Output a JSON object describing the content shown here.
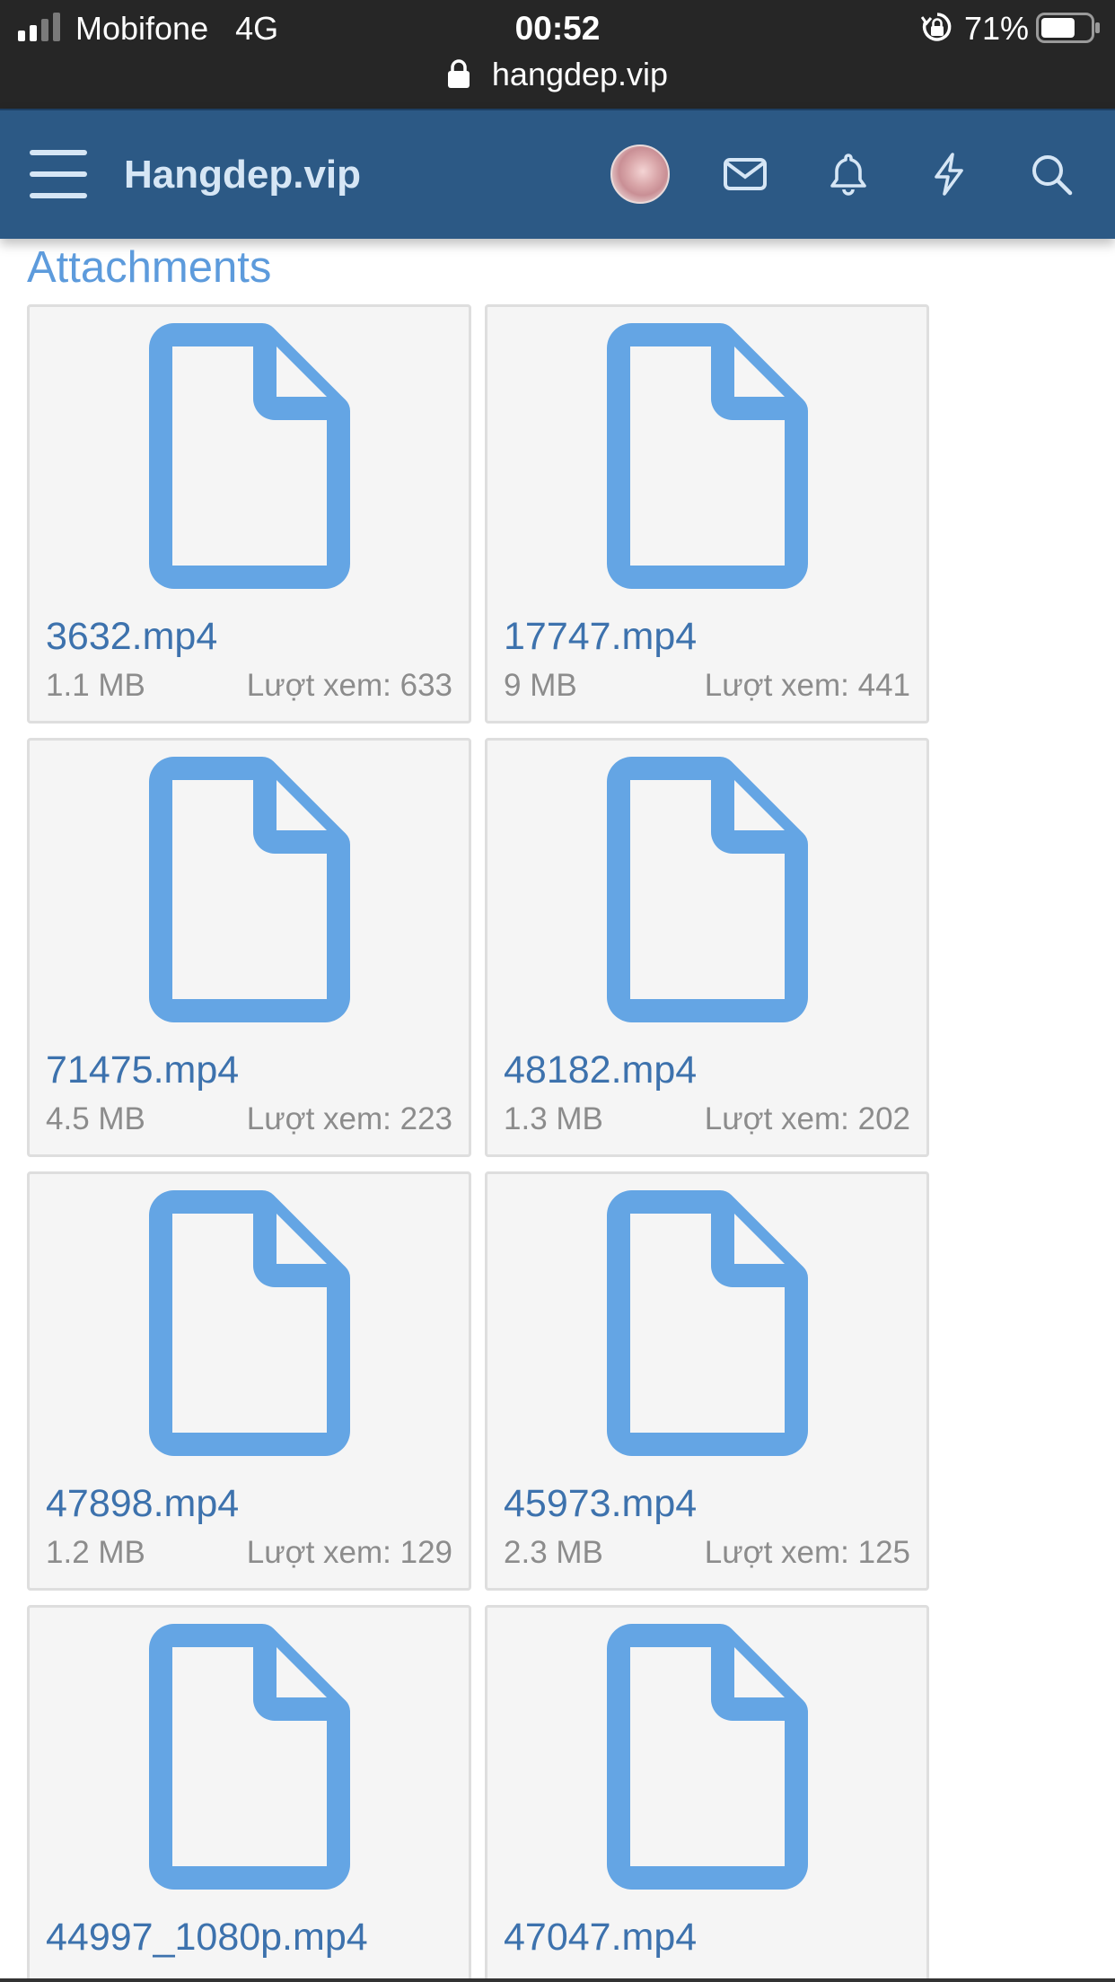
{
  "status_bar": {
    "carrier": "Mobifone",
    "network": "4G",
    "time": "00:52",
    "battery_percent": "71%",
    "battery_level": 0.71,
    "url": "hangdep.vip"
  },
  "header": {
    "brand": "Hangdep.vip",
    "icons": [
      "menu-icon",
      "avatar",
      "envelope-icon",
      "bell-icon",
      "bolt-icon",
      "search-icon"
    ],
    "background_color": "#2c5985"
  },
  "section_title": "Attachments",
  "accent_color": "#5d9bdc",
  "file_icon_color": "#64a5e4",
  "attachments": [
    {
      "name": "3632.mp4",
      "size": "1.1 MB",
      "views": "Lượt xem: 633"
    },
    {
      "name": "17747.mp4",
      "size": "9 MB",
      "views": "Lượt xem: 441"
    },
    {
      "name": "71475.mp4",
      "size": "4.5 MB",
      "views": "Lượt xem: 223"
    },
    {
      "name": "48182.mp4",
      "size": "1.3 MB",
      "views": "Lượt xem: 202"
    },
    {
      "name": "47898.mp4",
      "size": "1.2 MB",
      "views": "Lượt xem: 129"
    },
    {
      "name": "45973.mp4",
      "size": "2.3 MB",
      "views": "Lượt xem: 125"
    },
    {
      "name": "44997_1080p.mp4",
      "size": "",
      "views": ""
    },
    {
      "name": "47047.mp4",
      "size": "",
      "views": ""
    }
  ]
}
